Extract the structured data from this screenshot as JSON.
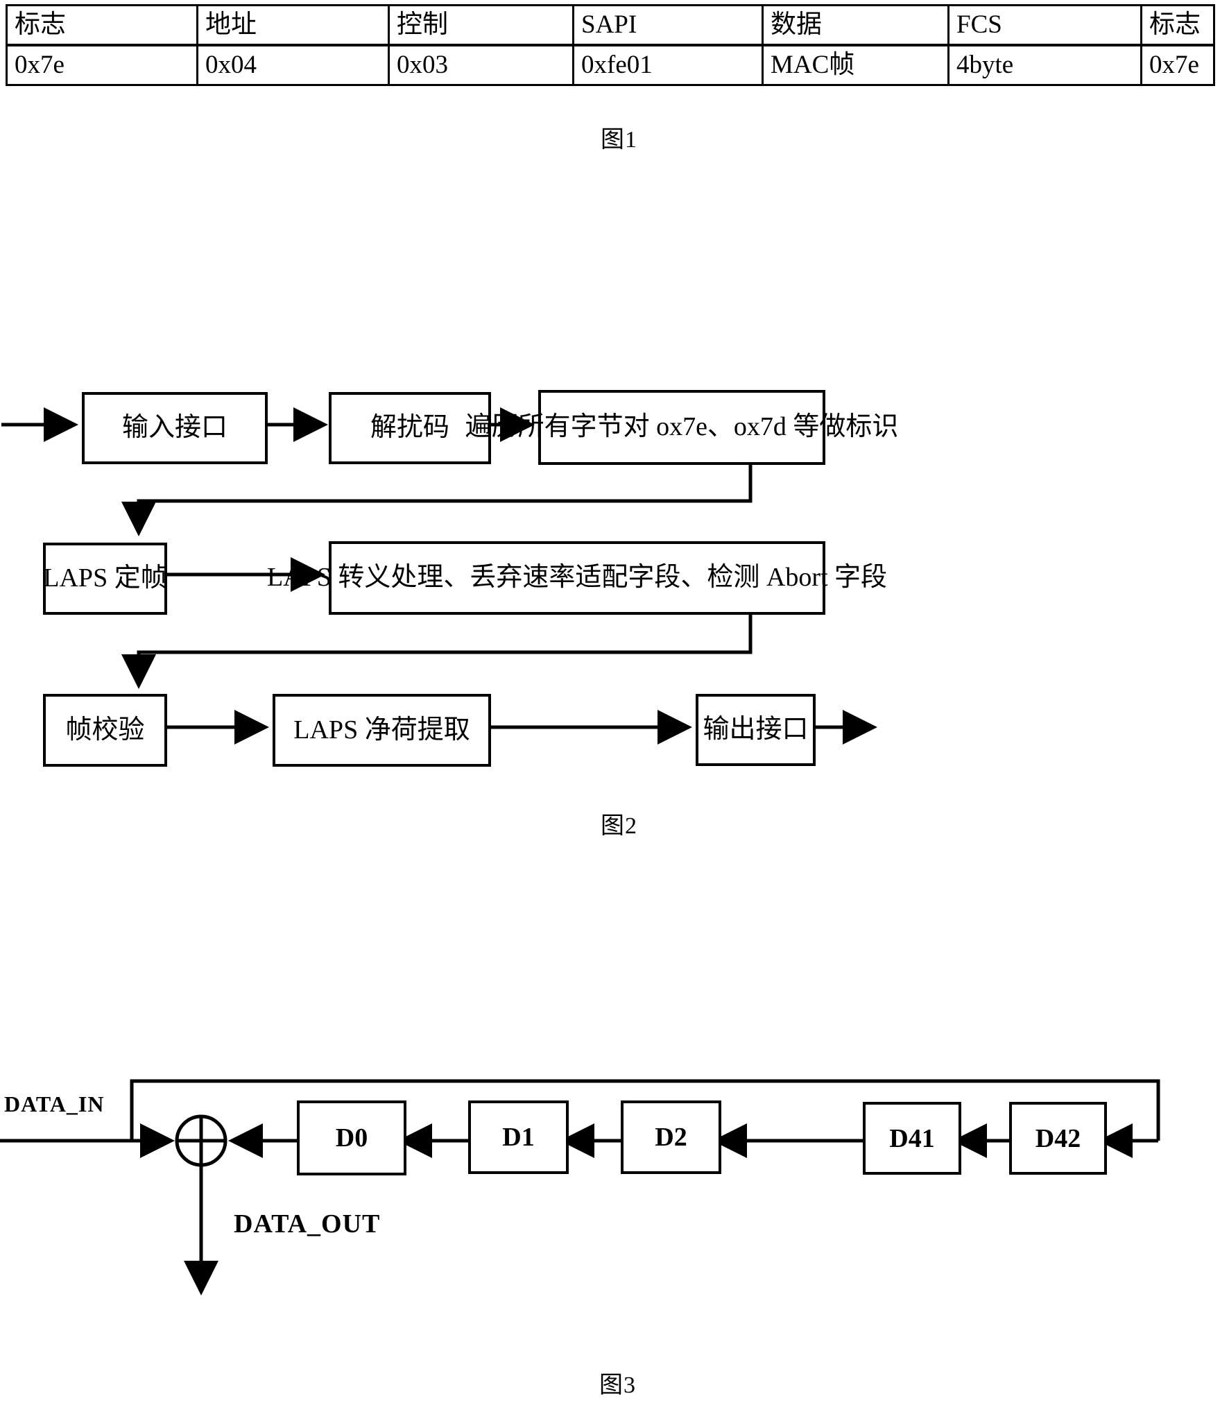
{
  "figures": [
    {
      "id": "fig1",
      "caption": "图1",
      "type": "table",
      "table": {
        "headers": [
          "标志",
          "地址",
          "控制",
          "SAPI",
          "数据",
          "FCS",
          "标志"
        ],
        "values": [
          "0x7e",
          "0x04",
          "0x03",
          "0xfe01",
          "MAC帧",
          "4byte",
          "0x7e"
        ]
      }
    },
    {
      "id": "fig2",
      "caption": "图2",
      "type": "flowchart",
      "nodes": [
        {
          "key": "input_interface",
          "label": "输入接口"
        },
        {
          "key": "descramble",
          "label": "解扰码"
        },
        {
          "key": "scan_bytes",
          "label": "遍历所有字节对 ox7e、ox7d 等做标识"
        },
        {
          "key": "laps_framing",
          "label": "LAPS 定帧"
        },
        {
          "key": "laps_escape",
          "label": "LAPS 转义处理、丢弃速率适配字段、检测 Abort 字段"
        },
        {
          "key": "frame_check",
          "label": "帧校验"
        },
        {
          "key": "laps_payload",
          "label": "LAPS 净荷提取"
        },
        {
          "key": "output_interface",
          "label": "输出接口"
        }
      ]
    },
    {
      "id": "fig3",
      "caption": "图3",
      "type": "shift-register",
      "signals": {
        "input": "DATA_IN",
        "output": "DATA_OUT"
      },
      "operator": "xor-gate",
      "registers": [
        {
          "key": "d0",
          "label": "D0"
        },
        {
          "key": "d1",
          "label": "D1"
        },
        {
          "key": "d2",
          "label": "D2"
        },
        {
          "key": "d41",
          "label": "D41"
        },
        {
          "key": "d42",
          "label": "D42"
        }
      ]
    }
  ],
  "colors": {
    "ink": "#000000",
    "paper": "#ffffff"
  }
}
